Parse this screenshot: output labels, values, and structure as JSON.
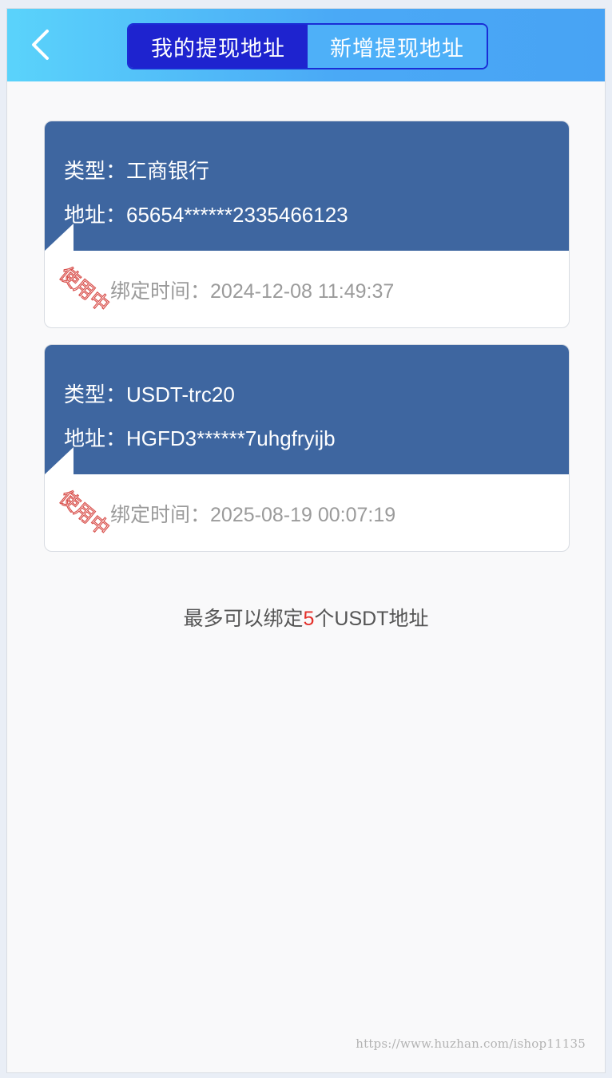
{
  "header": {
    "back_icon": "chevron-left-icon",
    "tabs": [
      {
        "label": "我的提现地址",
        "active": true
      },
      {
        "label": "新增提现地址",
        "active": false
      }
    ]
  },
  "cards": [
    {
      "type_label": "类型：",
      "type_value": "工商银行",
      "address_label": "地址：",
      "address_value": "65654******2335466123",
      "bind_time_label": "绑定时间：",
      "bind_time_value": "2024-12-08 11:49:37",
      "stamp_text": "使用中"
    },
    {
      "type_label": "类型：",
      "type_value": "USDT-trc20",
      "address_label": "地址：",
      "address_value": "HGFD3******7uhgfryijb",
      "bind_time_label": "绑定时间：",
      "bind_time_value": "2025-08-19 00:07:19",
      "stamp_text": "使用中"
    }
  ],
  "limit_note": {
    "prefix": "最多可以绑定",
    "count": "5",
    "suffix": "个USDT地址"
  },
  "watermark": "https://www.huzhan.com/ishop11135",
  "colors": {
    "header_gradient_start": "#5ad3fb",
    "header_gradient_end": "#48a3f4",
    "active_tab": "#1e23cf",
    "card_top": "#3e66a0",
    "stamp_red": "#d9534f",
    "limit_number": "#e4302a"
  }
}
